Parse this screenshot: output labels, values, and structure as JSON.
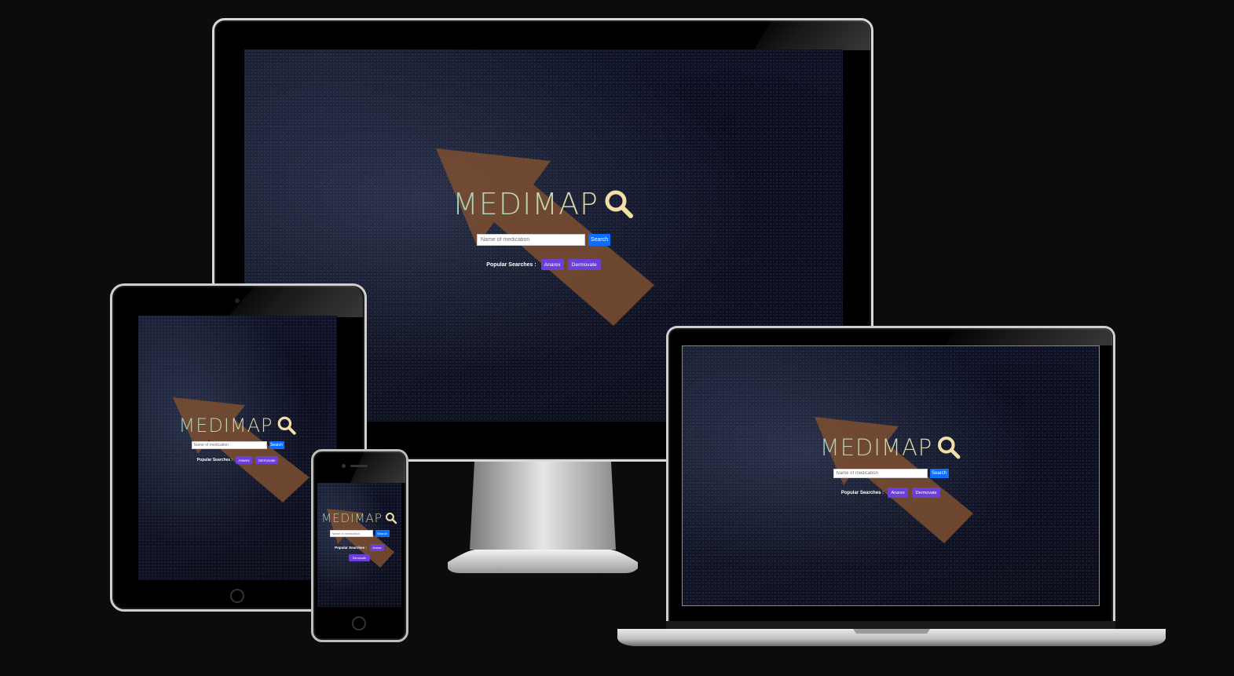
{
  "app": {
    "logo_text": "MEDIMAP",
    "search_placeholder": "Name of medication",
    "search_button": "Search",
    "popular_label": "Popular Searches :",
    "popular_tags": [
      "Anarex",
      "Dermovate"
    ]
  },
  "colors": {
    "background": "#0d0b0c",
    "search_button": "#0d6efd",
    "tag_button": "#6c3fd9",
    "logo_icon": "#f2dfa7",
    "arrow": "#8a5a35"
  },
  "icons": {
    "logo": "magnifier-icon"
  },
  "devices": [
    "desktop-monitor",
    "tablet",
    "laptop",
    "phone"
  ]
}
